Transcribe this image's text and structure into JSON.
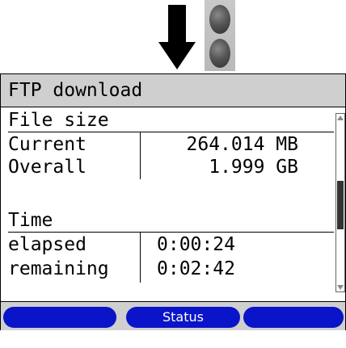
{
  "screen": {
    "title": "FTP download"
  },
  "file_size": {
    "heading": "File size",
    "rows": [
      {
        "label": "Current",
        "value": "264.014 MB"
      },
      {
        "label": "Overall",
        "value": "1.999 GB"
      }
    ]
  },
  "time": {
    "heading": "Time",
    "rows": [
      {
        "label": "elapsed",
        "value": "0:00:24"
      },
      {
        "label": "remaining",
        "value": "0:02:42"
      }
    ]
  },
  "softkeys": {
    "left": "",
    "middle": "Status",
    "right": ""
  },
  "colors": {
    "softkey": "#0a14c8",
    "title_bar": "#cfcfcf"
  },
  "icons": {
    "hint_arrow": "arrow-down-icon",
    "keypad": "keypad-key-icon"
  }
}
